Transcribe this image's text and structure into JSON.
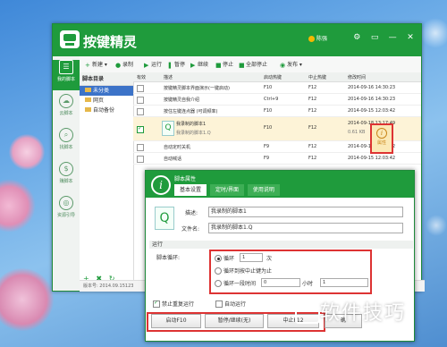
{
  "app": {
    "title": "按键精灵",
    "account": "陈强",
    "window_buttons": [
      "⚙",
      "▭",
      "—",
      "✕"
    ]
  },
  "nav": [
    {
      "label": "我的脚本",
      "glyph": "☰",
      "active": true
    },
    {
      "label": "云脚本",
      "glyph": "☁",
      "active": false
    },
    {
      "label": "找脚本",
      "glyph": "⌕",
      "active": false
    },
    {
      "label": "赚脚本",
      "glyph": "$",
      "active": false
    },
    {
      "label": "资源引导",
      "glyph": "◎",
      "active": false
    }
  ],
  "toolbar": {
    "new": "新建",
    "record": "录制",
    "run": "运行",
    "pause": "暂停",
    "resume": "继续",
    "stop": "停止",
    "stop_all": "全部停止",
    "publish": "发布"
  },
  "tree": {
    "header": "脚本目录",
    "items": [
      {
        "label": "未分类",
        "selected": true
      },
      {
        "label": "网页",
        "selected": false
      },
      {
        "label": "自动备份",
        "selected": false
      }
    ],
    "footer": [
      "+",
      "✖",
      "↻"
    ]
  },
  "statusbar": "版本号: 2014.09.15123",
  "table": {
    "headers": [
      "有效",
      "描述",
      "启动热键",
      "中止热键",
      "修改时间"
    ],
    "rows": [
      {
        "checked": false,
        "desc": "按键精灵脚本界面演示(一键启动)",
        "start": "F10",
        "stop": "F12",
        "time": "2014-09-16 14:30:23"
      },
      {
        "checked": false,
        "desc": "按键精灵自我介绍",
        "start": "Ctrl+9",
        "stop": "F12",
        "time": "2014-09-16 14:30:23"
      },
      {
        "checked": false,
        "desc": "按住左键连点器 (可调频率)",
        "start": "F10",
        "stop": "F12",
        "time": "2014-09-15 12:03:42"
      },
      {
        "checked": true,
        "desc": "我录制的脚本1",
        "desc2": "我录制的脚本1.Q",
        "start": "F10",
        "stop": "F12",
        "time": "2014-09-18 13:17:49",
        "size": "0.61 KB"
      },
      {
        "checked": false,
        "desc": "自动定时关机",
        "start": "F9",
        "stop": "F12",
        "time": "2014-09-15 12:03:42"
      },
      {
        "checked": false,
        "desc": "自动喊话",
        "start": "F9",
        "stop": "F12",
        "time": "2014-09-15 12:03:42"
      }
    ]
  },
  "side_info": {
    "label": "属性",
    "glyph": "i"
  },
  "dialog": {
    "title": "脚本属性",
    "tabs": [
      "基本设置",
      "定时/界面",
      "使用说明"
    ],
    "desc_label": "描述:",
    "desc_value": "我录制的脚本1",
    "file_label": "文件名:",
    "file_value": "我录制的脚本1.Q",
    "section": "运行",
    "loop_label": "脚本循环:",
    "opt1": "循环",
    "opt1_count": "1",
    "opt1_unit": "次",
    "opt2": "循环到按中止键为止",
    "opt3": "循环一段时间",
    "opt3_value": "0",
    "opt3_unit": "小时",
    "opt3_value2": "1",
    "forbid_repeat": "禁止重复运行",
    "auto_run": "自动运行",
    "btn_start": "启动F10",
    "btn_pause": "暂停/继续(无)",
    "btn_stop": "中止F12",
    "btn_ok": "确"
  },
  "watermark": "软件技巧"
}
